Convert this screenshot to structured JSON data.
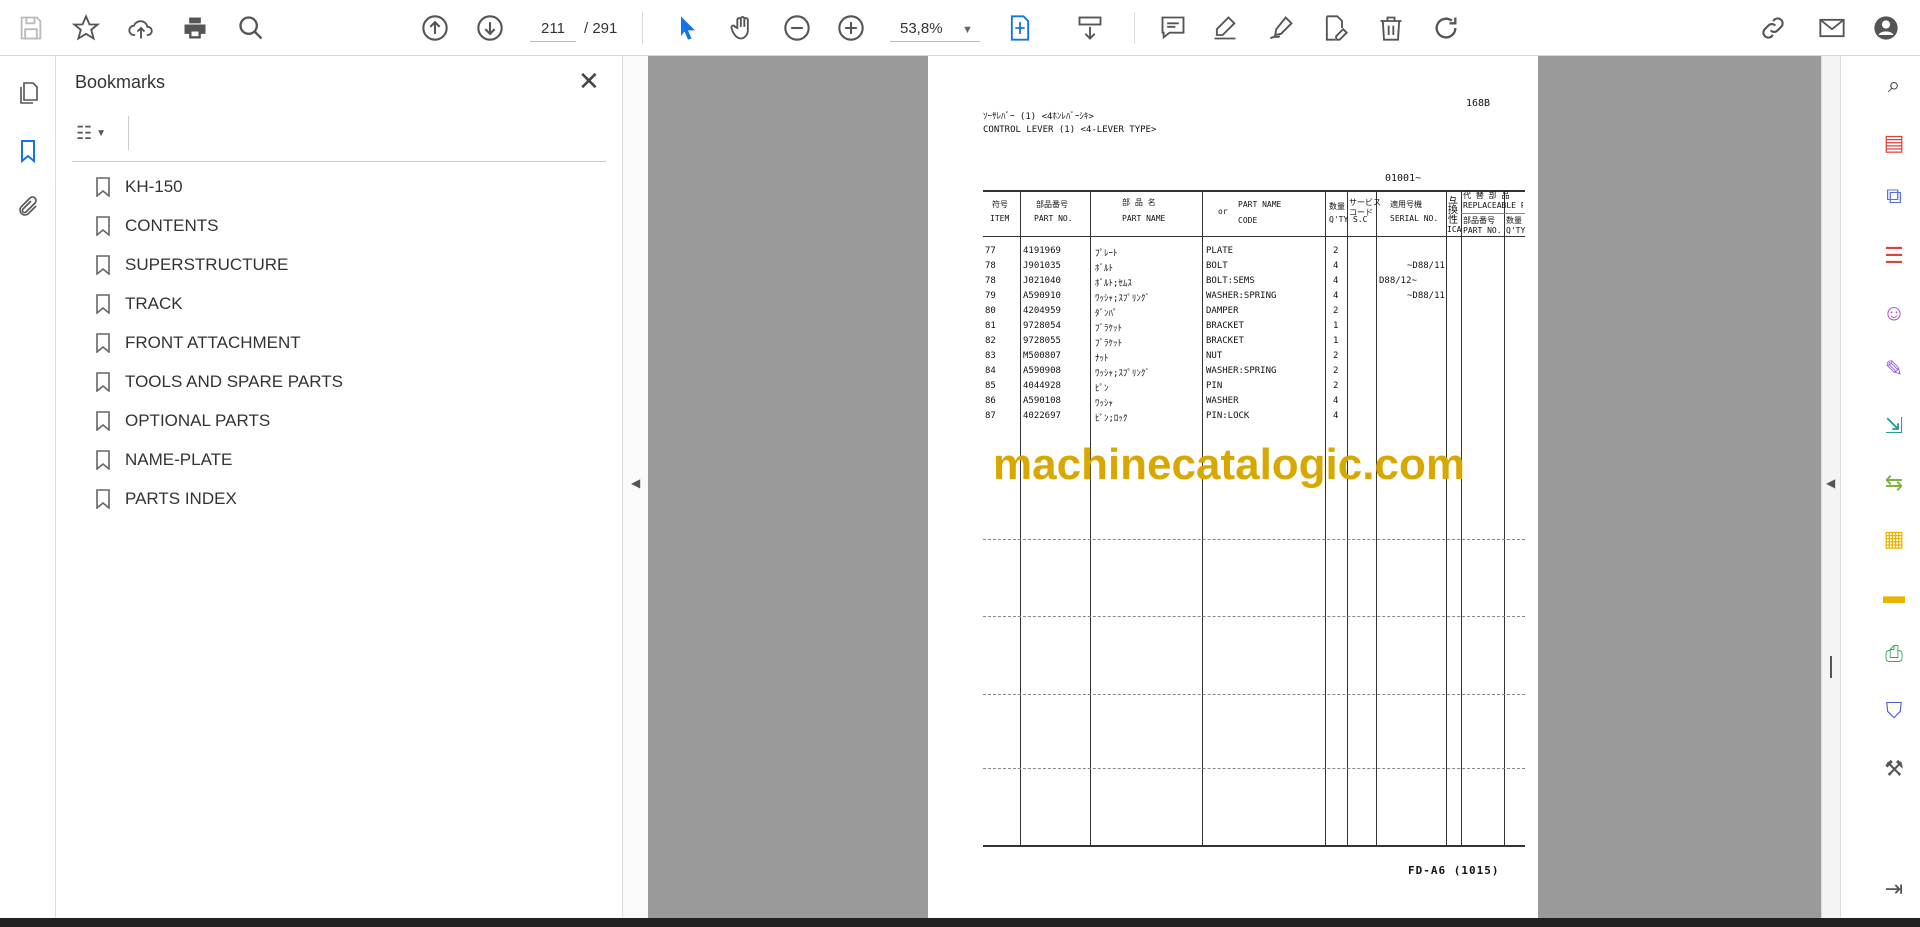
{
  "toolbar": {
    "current_page": "211",
    "total_pages": "/ 291",
    "zoom": "53,8%"
  },
  "colors": {
    "accent": "#1473e6",
    "watermark": "#d9a800",
    "doc_bg": "#9a9a9a"
  },
  "bookmarks": {
    "title": "Bookmarks",
    "items": [
      "KH-150",
      "CONTENTS",
      "SUPERSTRUCTURE",
      "TRACK",
      "FRONT ATTACHMENT",
      "TOOLS AND SPARE PARTS",
      "OPTIONAL PARTS",
      "NAME-PLATE",
      "PARTS INDEX"
    ]
  },
  "document": {
    "page_code": "168B",
    "title_jp": "ｿｰｻﾚﾊﾞｰ (1) <4ﾎﾝﾚﾊﾞｰｼｷ>",
    "title_en": "CONTROL LEVER (1) <4-LEVER TYPE>",
    "serial_range": "01001~",
    "headers": {
      "item_jp": "符号",
      "item": "ITEM",
      "partno_jp": "部品番号",
      "partno": "PART NO.",
      "name_jp": "部 品 名",
      "name": "PART NAME",
      "or": "or",
      "name_code": "PART NAME",
      "code": "CODE",
      "qty_jp": "数量",
      "qty": "Q'TY",
      "sc_jp": "サービス\nコード",
      "sc": "S.C",
      "serial_jp": "適用号機",
      "serial": "SERIAL NO.",
      "ica_jp": "互換性",
      "ica": "ICA",
      "repl_jp": "代 替 部 品",
      "repl": "REPLACEABLE PART",
      "repl_partno_jp": "部品番号",
      "repl_partno": "PART NO.",
      "repl_qty_jp": "数量",
      "repl_qty": "Q'TY"
    },
    "rows": [
      {
        "item": "77",
        "part_no": "4191969",
        "name_jp": "ﾌﾟﾚｰﾄ",
        "name": "PLATE",
        "qty": "2",
        "serial": ""
      },
      {
        "item": "78",
        "part_no": "J901035",
        "name_jp": "ﾎﾞﾙﾄ",
        "name": "BOLT",
        "qty": "4",
        "serial": "~D88/11"
      },
      {
        "item": "78",
        "part_no": "J021040",
        "name_jp": "ﾎﾞﾙﾄ;ｾﾑｽ",
        "name": "BOLT:SEMS",
        "qty": "4",
        "serial": "D88/12~"
      },
      {
        "item": "79",
        "part_no": "A590910",
        "name_jp": "ﾜｯｼｬ;ｽﾌﾟﾘﾝｸﾞ",
        "name": "WASHER:SPRING",
        "qty": "4",
        "serial": "~D88/11"
      },
      {
        "item": "80",
        "part_no": "4204959",
        "name_jp": "ﾀﾞﾝﾊﾟ",
        "name": "DAMPER",
        "qty": "2",
        "serial": ""
      },
      {
        "item": "81",
        "part_no": "9728054",
        "name_jp": "ﾌﾞﾗｹｯﾄ",
        "name": "BRACKET",
        "qty": "1",
        "serial": ""
      },
      {
        "item": "82",
        "part_no": "9728055",
        "name_jp": "ﾌﾞﾗｹｯﾄ",
        "name": "BRACKET",
        "qty": "1",
        "serial": ""
      },
      {
        "item": "83",
        "part_no": "M500807",
        "name_jp": "ﾅｯﾄ",
        "name": "NUT",
        "qty": "2",
        "serial": ""
      },
      {
        "item": "84",
        "part_no": "A590908",
        "name_jp": "ﾜｯｼｬ;ｽﾌﾟﾘﾝｸﾞ",
        "name": "WASHER:SPRING",
        "qty": "2",
        "serial": ""
      },
      {
        "item": "85",
        "part_no": "4044928",
        "name_jp": "ﾋﾟﾝ",
        "name": "PIN",
        "qty": "2",
        "serial": ""
      },
      {
        "item": "86",
        "part_no": "A590108",
        "name_jp": "ﾜｯｼｬ",
        "name": "WASHER",
        "qty": "4",
        "serial": ""
      },
      {
        "item": "87",
        "part_no": "4022697",
        "name_jp": "ﾋﾟﾝ;ﾛｯｸ",
        "name": "PIN:LOCK",
        "qty": "4",
        "serial": ""
      }
    ],
    "footer": "FD-A6 (1015)",
    "watermark": "machinecatalogic.com"
  }
}
